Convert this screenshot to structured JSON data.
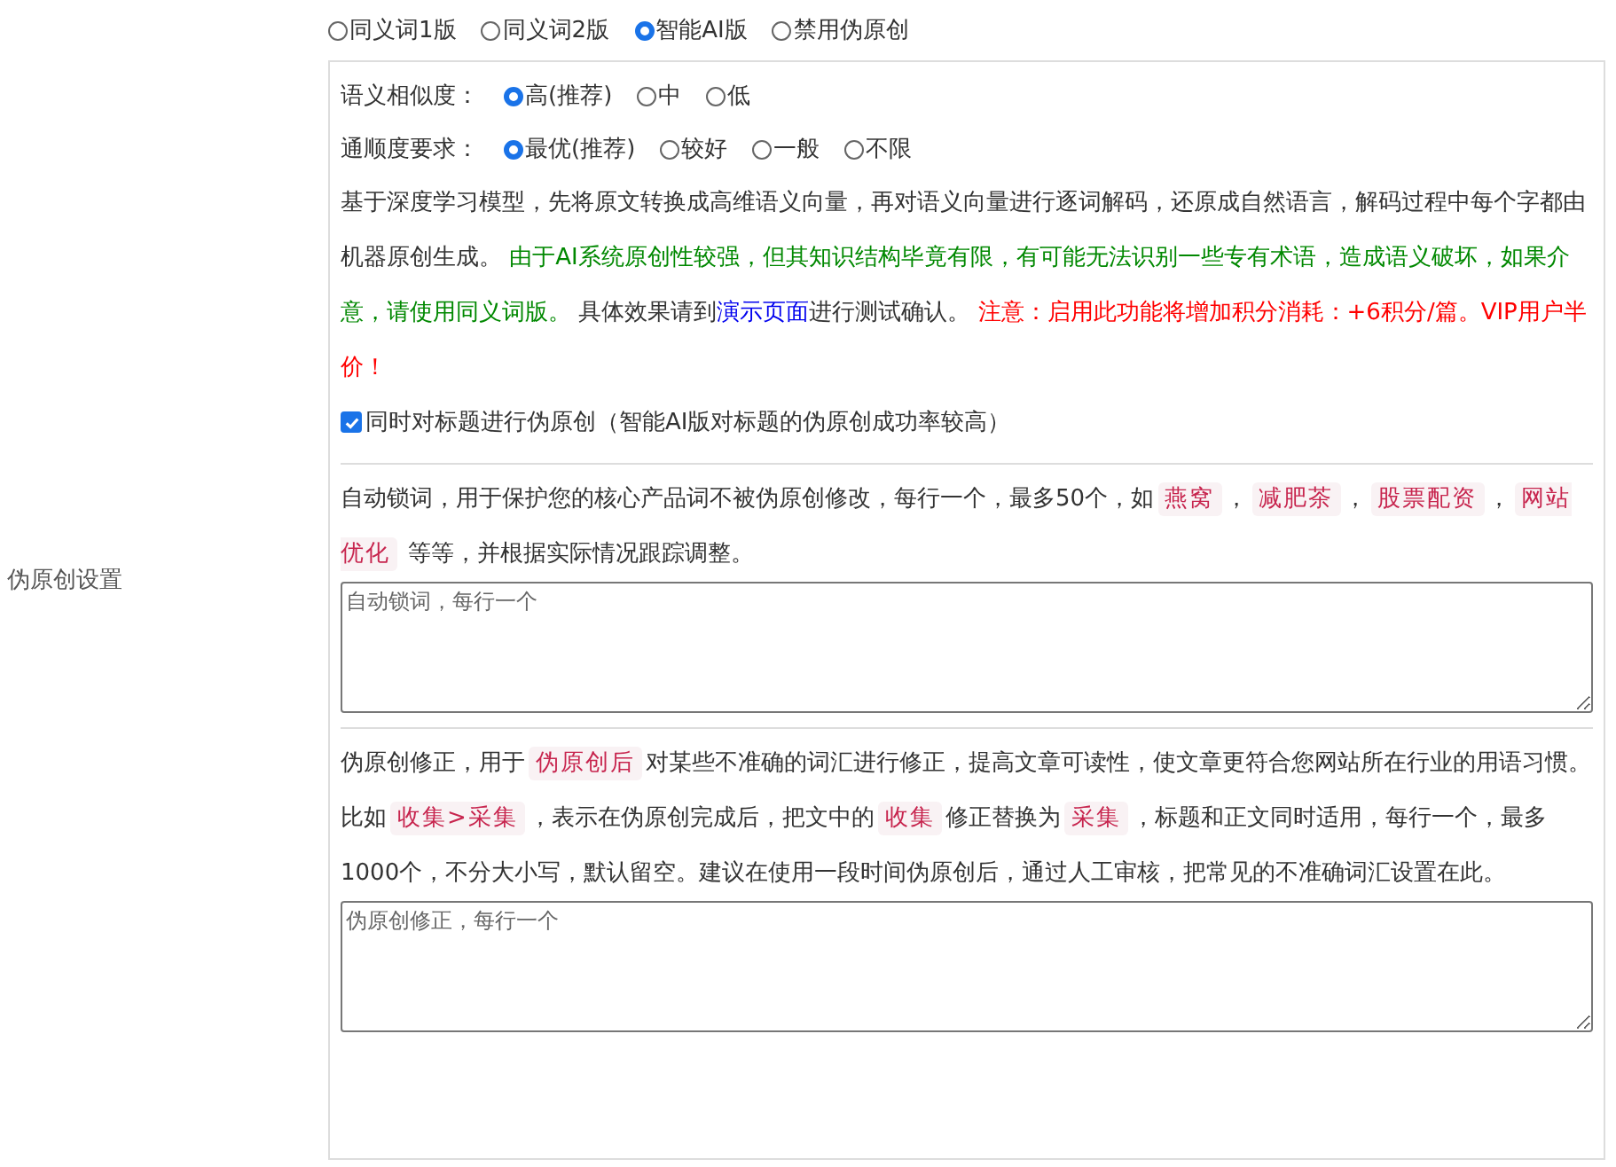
{
  "section_label": "伪原创设置",
  "modes": [
    {
      "label": "同义词1版",
      "selected": false
    },
    {
      "label": "同义词2版",
      "selected": false
    },
    {
      "label": "智能AI版",
      "selected": true
    },
    {
      "label": "禁用伪原创",
      "selected": false
    }
  ],
  "similarity": {
    "label": "语义相似度：",
    "options": [
      {
        "label": "高(推荐)",
        "selected": true
      },
      {
        "label": "中",
        "selected": false
      },
      {
        "label": "低",
        "selected": false
      }
    ]
  },
  "fluency": {
    "label": "通顺度要求：",
    "options": [
      {
        "label": "最优(推荐)",
        "selected": true
      },
      {
        "label": "较好",
        "selected": false
      },
      {
        "label": "一般",
        "selected": false
      },
      {
        "label": "不限",
        "selected": false
      }
    ]
  },
  "ai_description": [
    {
      "kind": "plain",
      "text": "基于深度学习模型，先将原文转换成高维语义向量，再对语义向量进行逐词解码，还原成自然语言，解码过程中每个字都由机器原创生成。 "
    },
    {
      "kind": "green",
      "text": "由于AI系统原创性较强，但其知识结构毕竟有限，有可能无法识别一些专有术语，造成语义破坏，如果介意，请使用同义词版。"
    },
    {
      "kind": "plain",
      "text": " 具体效果请到"
    },
    {
      "kind": "link",
      "text": "演示页面"
    },
    {
      "kind": "plain",
      "text": "进行测试确认。 "
    },
    {
      "kind": "red",
      "text": "注意：启用此功能将增加积分消耗：+6积分/篇。VIP用户半价！"
    }
  ],
  "title_rewrite": {
    "label": "同时对标题进行伪原创（智能AI版对标题的伪原创成功率较高）",
    "checked": true
  },
  "lock_words": {
    "description": [
      {
        "kind": "plain",
        "text": "自动锁词，用于保护您的核心产品词不被伪原创修改，每行一个，最多50个，如"
      },
      {
        "kind": "code",
        "text": "燕窝"
      },
      {
        "kind": "plain",
        "text": "，"
      },
      {
        "kind": "code",
        "text": "减肥茶"
      },
      {
        "kind": "plain",
        "text": "，"
      },
      {
        "kind": "code",
        "text": "股票配资"
      },
      {
        "kind": "plain",
        "text": "，"
      },
      {
        "kind": "code",
        "text": "网站优化"
      },
      {
        "kind": "plain",
        "text": " 等等，并根据实际情况跟踪调整。"
      }
    ],
    "placeholder": "自动锁词，每行一个"
  },
  "corrections": {
    "description": [
      {
        "kind": "plain",
        "text": "伪原创修正，用于"
      },
      {
        "kind": "code",
        "text": "伪原创后"
      },
      {
        "kind": "plain",
        "text": "对某些不准确的词汇进行修正，提高文章可读性，使文章更符合您网站所在行业的用语习惯。比如"
      },
      {
        "kind": "code",
        "text": "收集>采集"
      },
      {
        "kind": "plain",
        "text": "，表示在伪原创完成后，把文中的"
      },
      {
        "kind": "code",
        "text": "收集"
      },
      {
        "kind": "plain",
        "text": "修正替换为"
      },
      {
        "kind": "code",
        "text": "采集"
      },
      {
        "kind": "plain",
        "text": "，标题和正文同时适用，每行一个，最多1000个，不分大小写，默认留空。建议在使用一段时间伪原创后，通过人工审核，把常见的不准确词汇设置在此。"
      }
    ],
    "placeholder": "伪原创修正，每行一个"
  }
}
